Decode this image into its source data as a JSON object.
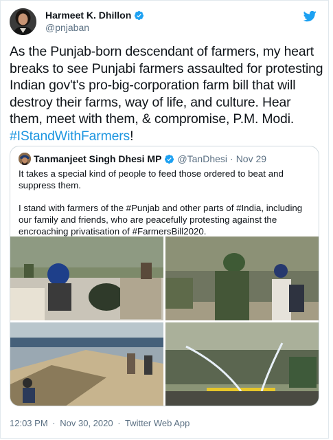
{
  "author": {
    "name": "Harmeet K. Dhillon",
    "handle": "@pnjaban"
  },
  "tweet": {
    "text_main": "As the Punjab-born descendant of farmers, my heart breaks to see Punjabi farmers assaulted for protesting Indian gov't's pro-big-corporation farm bill that will destroy their farms, way of life, and culture. Hear them, meet with them, & compromise, P.M. Modi.",
    "hashtag": "#IStandWithFarmers",
    "suffix": "!"
  },
  "quoted": {
    "name": "Tanmanjeet Singh Dhesi MP",
    "handle": "@TanDhesi",
    "separator": "·",
    "date": "Nov 29",
    "paragraph1": "It takes a special kind of people to feed those ordered to beat and suppress them.",
    "paragraph2": "I stand with farmers of the #Punjab and other parts of #India, including our family and friends, who are peacefully protesting against the encroaching privatisation of #FarmersBill2020."
  },
  "footer": {
    "time": "12:03 PM",
    "sep1": "·",
    "date": "Nov 30, 2020",
    "sep2": "·",
    "source": "Twitter Web App"
  },
  "colors": {
    "link": "#1b95e0",
    "verified": "#1da1f2",
    "secondary_text": "#5b7083",
    "border": "#cfd9de"
  },
  "icons": {
    "verified": "verified-badge-icon",
    "logo": "twitter-bird-icon"
  }
}
